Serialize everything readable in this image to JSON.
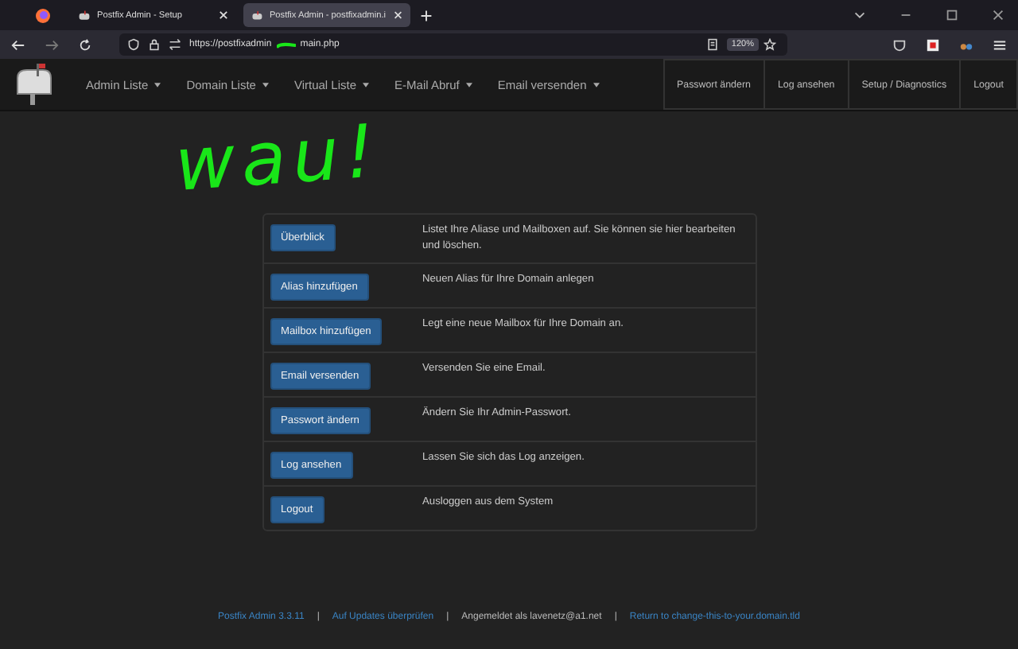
{
  "browser": {
    "tabs": [
      {
        "title": "Postfix Admin - Setup",
        "selected": false
      },
      {
        "title": "Postfix Admin - postfixadmin.i",
        "selected": true
      }
    ],
    "url_start": "https://postfixadmin",
    "url_end": "main.php",
    "zoom": "120%"
  },
  "navbar": {
    "menus": [
      "Admin Liste",
      "Domain Liste",
      "Virtual Liste",
      "E-Mail Abruf",
      "Email versenden"
    ],
    "buttons": [
      "Passwort ändern",
      "Log ansehen",
      "Setup / Diagnostics",
      "Logout"
    ]
  },
  "annotation": "wau!",
  "actions": [
    {
      "button": "Überblick",
      "description": "Listet Ihre Aliase und Mailboxen auf. Sie können sie hier bearbeiten und löschen."
    },
    {
      "button": "Alias hinzufügen",
      "description": "Neuen Alias für Ihre Domain anlegen"
    },
    {
      "button": "Mailbox hinzufügen",
      "description": "Legt eine neue Mailbox für Ihre Domain an."
    },
    {
      "button": "Email versenden",
      "description": "Versenden Sie eine Email."
    },
    {
      "button": "Passwort ändern",
      "description": "Ändern Sie Ihr Admin-Passwort."
    },
    {
      "button": "Log ansehen",
      "description": "Lassen Sie sich das Log anzeigen."
    },
    {
      "button": "Logout",
      "description": "Ausloggen aus dem System"
    }
  ],
  "footer": [
    {
      "kind": "link",
      "text": "Postfix Admin 3.3.11"
    },
    {
      "kind": "link",
      "text": "Auf Updates überprüfen"
    },
    {
      "kind": "text",
      "text": "Angemeldet als lavenetz@a1.net"
    },
    {
      "kind": "link",
      "text": "Return to change-this-to-your.domain.tld"
    }
  ],
  "footer_separator": "|"
}
